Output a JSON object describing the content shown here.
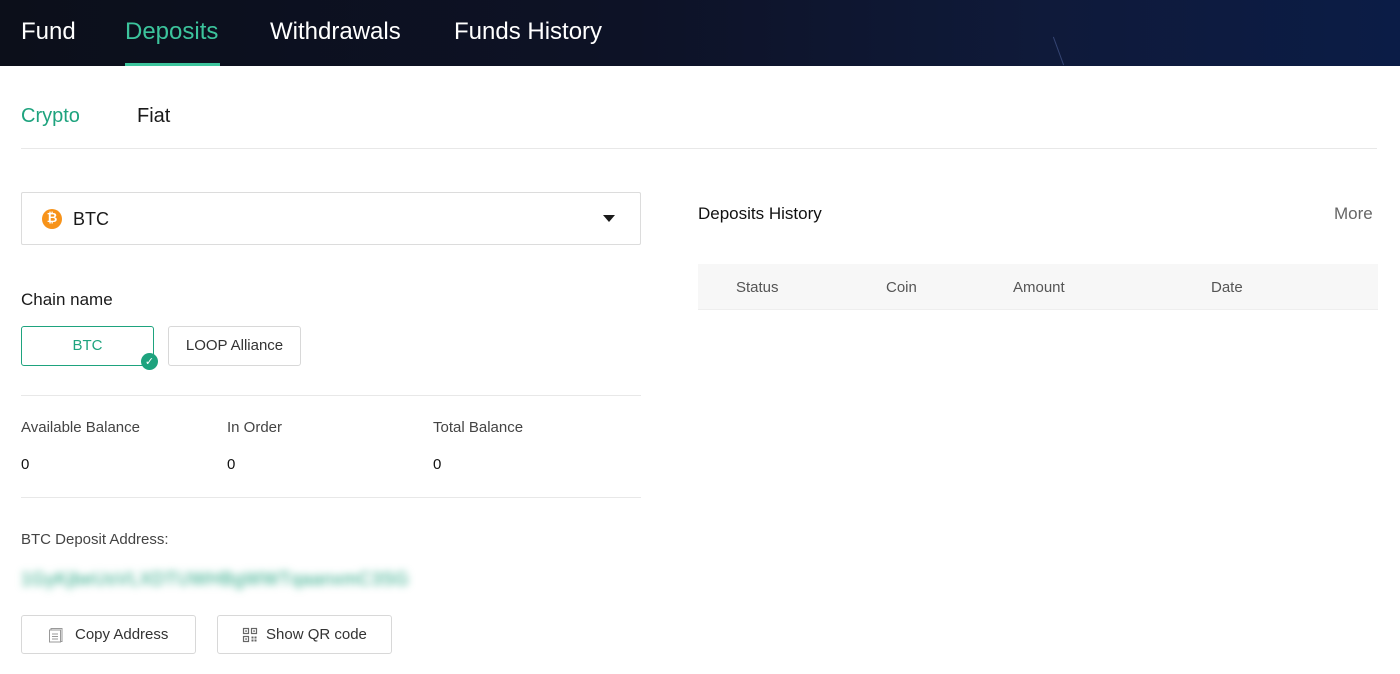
{
  "topnav": {
    "items": [
      {
        "label": "Fund",
        "active": false
      },
      {
        "label": "Deposits",
        "active": true
      },
      {
        "label": "Withdrawals",
        "active": false
      },
      {
        "label": "Funds History",
        "active": false
      }
    ],
    "accent_color": "#3cc49c"
  },
  "subtabs": [
    {
      "label": "Crypto",
      "active": true
    },
    {
      "label": "Fiat",
      "active": false
    }
  ],
  "coin_select": {
    "icon": "bitcoin-icon",
    "value": "BTC"
  },
  "chain": {
    "label": "Chain name",
    "options": [
      {
        "label": "BTC",
        "selected": true
      },
      {
        "label": "LOOP Alliance",
        "selected": false
      }
    ]
  },
  "balances": [
    {
      "label": "Available Balance",
      "value": "0"
    },
    {
      "label": "In Order",
      "value": "0"
    },
    {
      "label": "Total Balance",
      "value": "0"
    }
  ],
  "deposit": {
    "address_label": "BTC Deposit Address:",
    "address": "1GyKjbeUsVLXDTUWHBgWWTqaanxmC3SG",
    "copy_label": "Copy Address",
    "qr_label": "Show QR code"
  },
  "history": {
    "title": "Deposits History",
    "more": "More",
    "columns": [
      "Status",
      "Coin",
      "Amount",
      "Date"
    ]
  },
  "colors": {
    "brand_green": "#1ea37e",
    "bitcoin_orange": "#f7931a"
  }
}
